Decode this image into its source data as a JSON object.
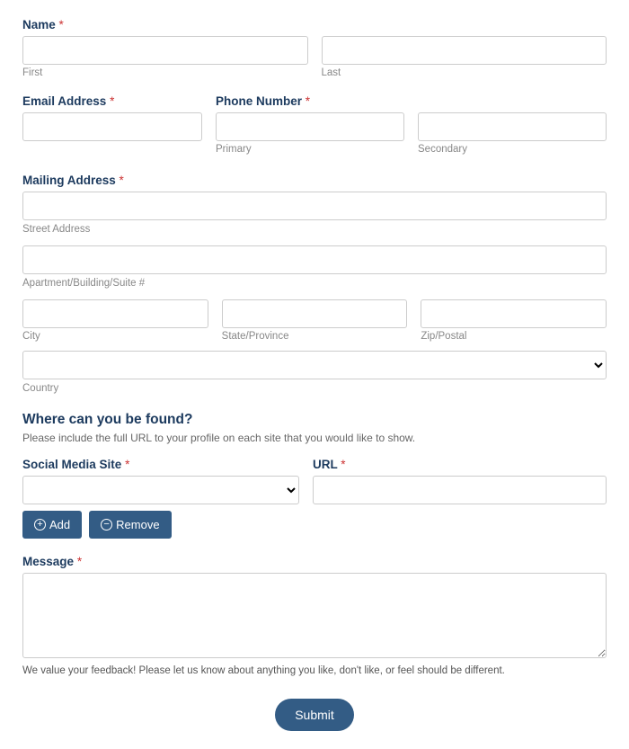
{
  "name": {
    "label": "Name",
    "first_value": "",
    "first_sublabel": "First",
    "last_value": "",
    "last_sublabel": "Last"
  },
  "email": {
    "label": "Email Address",
    "value": ""
  },
  "phone": {
    "label": "Phone Number",
    "primary_value": "",
    "primary_sublabel": "Primary",
    "secondary_value": "",
    "secondary_sublabel": "Secondary"
  },
  "mailing": {
    "label": "Mailing Address",
    "street_value": "",
    "street_sublabel": "Street Address",
    "apt_value": "",
    "apt_sublabel": "Apartment/Building/Suite #",
    "city_value": "",
    "city_sublabel": "City",
    "state_value": "",
    "state_sublabel": "State/Province",
    "zip_value": "",
    "zip_sublabel": "Zip/Postal",
    "country_value": "",
    "country_sublabel": "Country"
  },
  "social_section": {
    "heading": "Where can you be found?",
    "description": "Please include the full URL to your profile on each site that you would like to show."
  },
  "social": {
    "site_label": "Social Media Site",
    "site_value": "",
    "url_label": "URL",
    "url_value": ""
  },
  "buttons": {
    "add": "Add",
    "remove": "Remove",
    "submit": "Submit"
  },
  "message": {
    "label": "Message",
    "value": "",
    "helper": "We value your feedback! Please let us know about anything you like, don't like, or feel should be different."
  },
  "required_mark": "*"
}
